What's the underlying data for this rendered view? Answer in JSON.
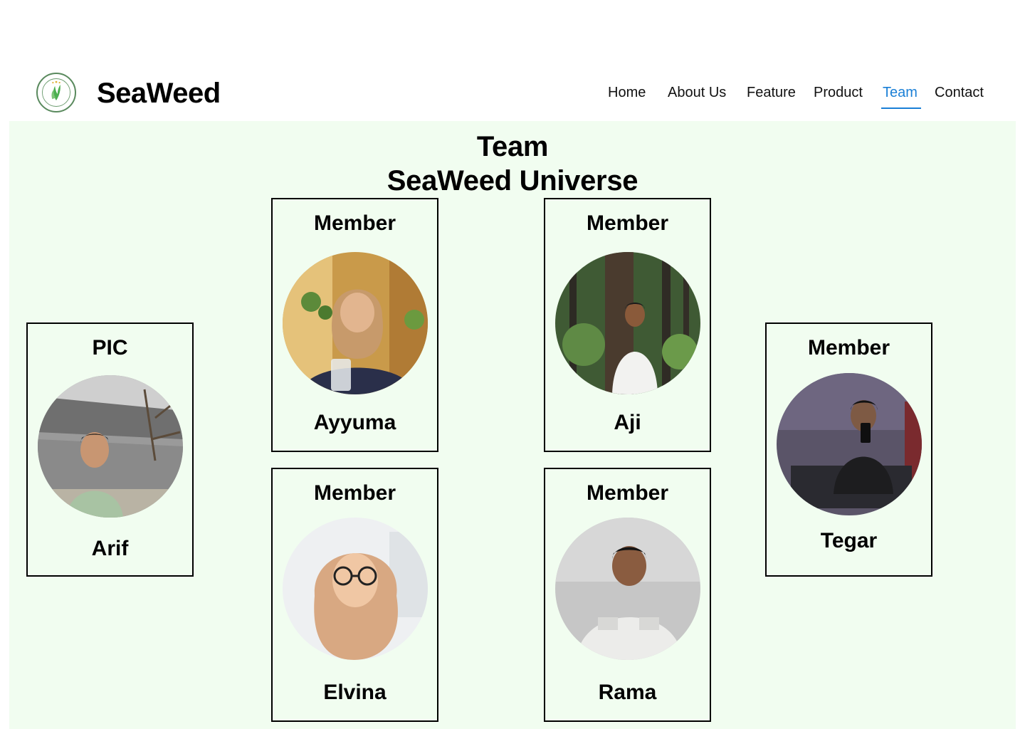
{
  "header": {
    "brand": "SeaWeed",
    "logo_icon": "seaweed-universe-logo",
    "nav": {
      "home": "Home",
      "about": "About Us",
      "feature": "Feature",
      "product": "Product",
      "team": "Team",
      "contact": "Contact"
    },
    "active_nav": "Team",
    "accent_color": "#1a7fd6"
  },
  "main": {
    "title_line1": "Team",
    "title_line2": "SeaWeed Universe",
    "background_color": "#f1fdf0",
    "members": [
      {
        "role": "PIC",
        "name": "Arif"
      },
      {
        "role": "Member",
        "name": "Ayyuma"
      },
      {
        "role": "Member",
        "name": "Aji"
      },
      {
        "role": "Member",
        "name": "Elvina"
      },
      {
        "role": "Member",
        "name": "Rama"
      },
      {
        "role": "Member",
        "name": "Tegar"
      }
    ]
  }
}
